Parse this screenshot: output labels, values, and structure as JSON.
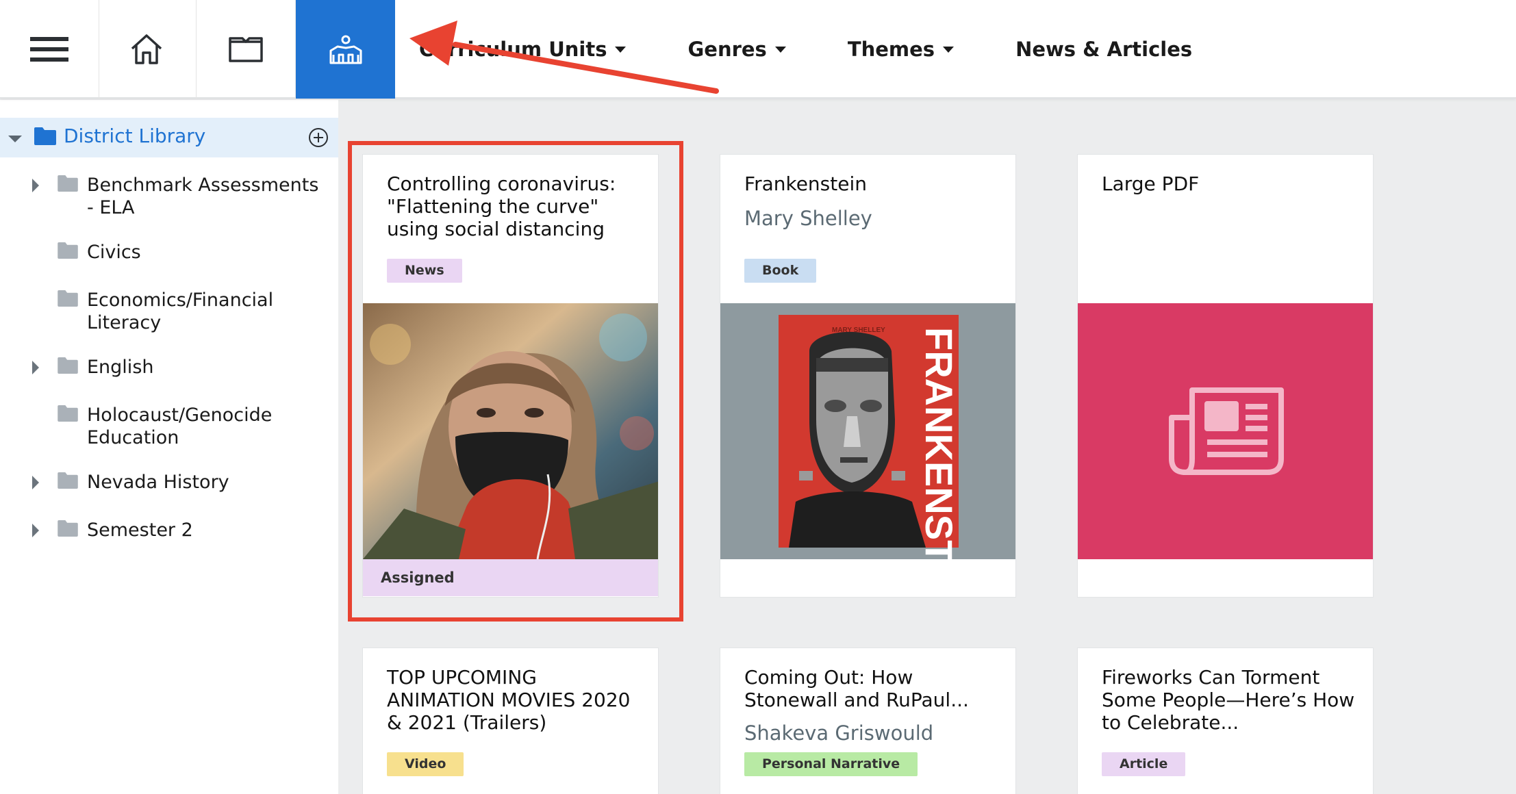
{
  "topbar": {
    "icons": [
      "menu-icon",
      "home-icon",
      "open-book-icon",
      "library-icon"
    ],
    "active_icon": "library-icon",
    "accent_color": "#1f73d2",
    "nav": [
      {
        "label": "Curriculum Units",
        "dropdown": true
      },
      {
        "label": "Genres",
        "dropdown": true
      },
      {
        "label": "Themes",
        "dropdown": true
      },
      {
        "label": "News & Articles",
        "dropdown": false
      }
    ]
  },
  "sidebar": {
    "library_label": "District Library",
    "items": [
      {
        "label": "Benchmark Assessments - ELA",
        "expandable": true
      },
      {
        "label": "Civics",
        "expandable": false
      },
      {
        "label": "Economics/Financial Literacy",
        "expandable": false
      },
      {
        "label": "English",
        "expandable": true
      },
      {
        "label": "Holocaust/Genocide Education",
        "expandable": false
      },
      {
        "label": "Nevada History",
        "expandable": true
      },
      {
        "label": "Semester 2",
        "expandable": true
      }
    ]
  },
  "cards": [
    {
      "title": "Controlling coronavirus: \"Flattening the curve\" using social distancing",
      "author": "",
      "tag": "News",
      "tag_color": "#ead6f3",
      "thumbnail": "masked-woman-photo",
      "status": "Assigned",
      "highlighted": true
    },
    {
      "title": "Frankenstein",
      "author": "Mary Shelley",
      "tag": "Book",
      "tag_color": "#c9ddf2",
      "thumbnail": "frankenstein-book-cover",
      "cover_text": {
        "author": "MARY SHELLEY",
        "title": "FRANKENSTEIN"
      }
    },
    {
      "title": "Large PDF",
      "author": "",
      "tag": "",
      "thumbnail": "newspaper-icon",
      "thumb_color": "#d93a64"
    },
    {
      "title": "TOP UPCOMING ANIMATION MOVIES 2020 & 2021 (Trailers)",
      "author": "",
      "tag": "Video",
      "tag_color": "#f7e08e"
    },
    {
      "title": "Coming Out: How Stonewall and RuPaul...",
      "author": "Shakeva Griswould",
      "tag": "Personal Narrative",
      "tag_color": "#b8eaa4"
    },
    {
      "title": "Fireworks Can Torment Some People—Here’s How to Celebrate...",
      "author": "",
      "tag": "Article",
      "tag_color": "#ead6f3"
    }
  ],
  "annotation": {
    "highlight_color": "#e84331"
  }
}
